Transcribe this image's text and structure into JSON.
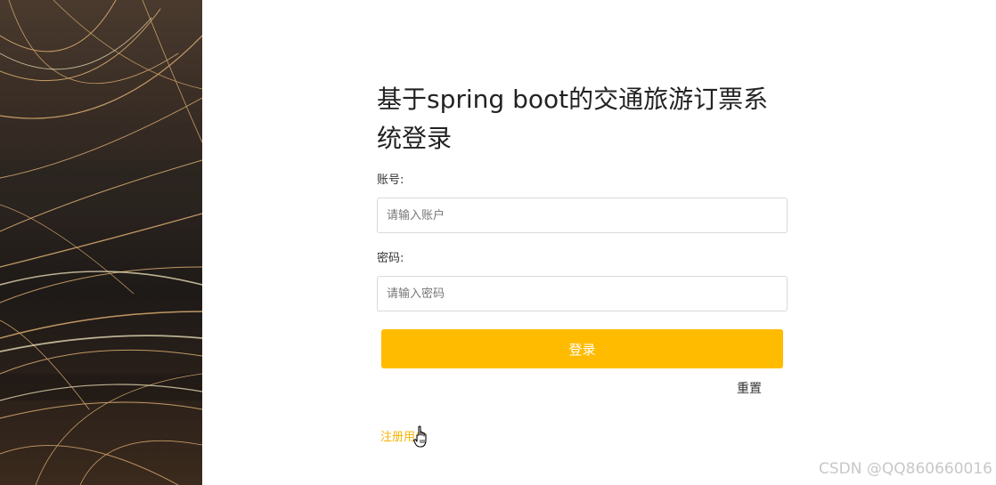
{
  "login": {
    "title": "基于spring boot的交通旅游订票系统登录",
    "username_label": "账号:",
    "username_placeholder": "请输入账户",
    "password_label": "密码:",
    "password_placeholder": "请输入密码",
    "login_button": "登录",
    "reset_button": "重置",
    "register_link": "注册用户"
  },
  "watermark": "CSDN @QQ860660016",
  "colors": {
    "accent": "#ffbb00",
    "link": "#f5b400",
    "title": "#222222"
  },
  "icons": {
    "cursor": "hand-pointer-icon"
  }
}
